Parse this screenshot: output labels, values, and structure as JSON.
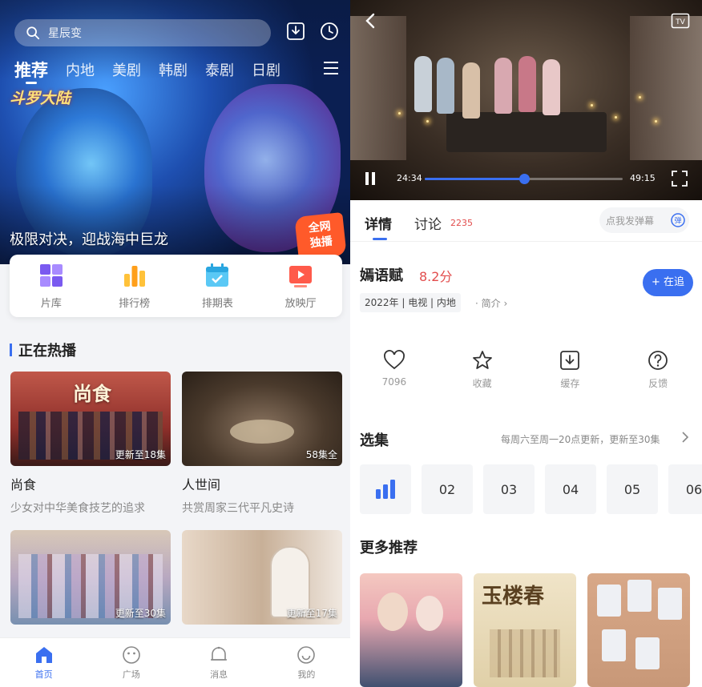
{
  "left": {
    "search": {
      "placeholder": "星辰变"
    },
    "tabs": [
      "推荐",
      "内地",
      "美剧",
      "韩剧",
      "泰剧",
      "日剧"
    ],
    "hero": {
      "logo_text": "斗罗大陆",
      "caption": "极限对决，迎战海中巨龙",
      "badge_line1": "全网",
      "badge_line2": "独播"
    },
    "quick_links": [
      {
        "label": "片库",
        "icon": "library-icon"
      },
      {
        "label": "排行榜",
        "icon": "ranking-icon"
      },
      {
        "label": "排期表",
        "icon": "schedule-icon"
      },
      {
        "label": "放映厅",
        "icon": "theater-icon"
      }
    ],
    "section_title": "正在热播",
    "cards": [
      {
        "thumb_title": "尚食",
        "tag": "更新至18集",
        "title": "尚食",
        "subtitle": "少女对中华美食技艺的追求"
      },
      {
        "thumb_title": "",
        "tag": "58集全",
        "title": "人世间",
        "subtitle": "共赏周家三代平凡史诗"
      },
      {
        "thumb_title": "",
        "tag": "更新至30集",
        "title": "",
        "subtitle": ""
      },
      {
        "thumb_title": "",
        "tag": "更新至17集",
        "title": "",
        "subtitle": ""
      }
    ],
    "bottom_nav": [
      {
        "label": "首页",
        "icon": "home-icon"
      },
      {
        "label": "广场",
        "icon": "plaza-icon"
      },
      {
        "label": "消息",
        "icon": "message-icon"
      },
      {
        "label": "我的",
        "icon": "profile-icon"
      }
    ],
    "colors": {
      "accent": "#3a6ff0"
    }
  },
  "right": {
    "player": {
      "current_time": "24:34",
      "total_time": "49:15",
      "progress_fraction": 0.5,
      "tv_label": "TV"
    },
    "tabs": {
      "details": "详情",
      "discussion": "讨论",
      "discussion_count": "2235"
    },
    "danmu_placeholder": "点我发弹幕",
    "show": {
      "title": "嫣语赋",
      "score": "8.2分",
      "meta": "2022年 | 电视 | 内地",
      "intro": "· 简介",
      "follow_label": "+ 在追"
    },
    "actions": [
      {
        "label": "7096",
        "icon": "heart-icon"
      },
      {
        "label": "收藏",
        "icon": "star-icon"
      },
      {
        "label": "缓存",
        "icon": "download-icon"
      },
      {
        "label": "反馈",
        "icon": "question-icon"
      }
    ],
    "episodes": {
      "title": "选集",
      "note": "每周六至周一20点更新，更新至30集",
      "items": [
        "02",
        "03",
        "04",
        "05",
        "06"
      ]
    },
    "more_title": "更多推荐",
    "recommendations": [
      {
        "poster_text": ""
      },
      {
        "poster_text": "玉楼春"
      },
      {
        "poster_text": ""
      }
    ]
  }
}
